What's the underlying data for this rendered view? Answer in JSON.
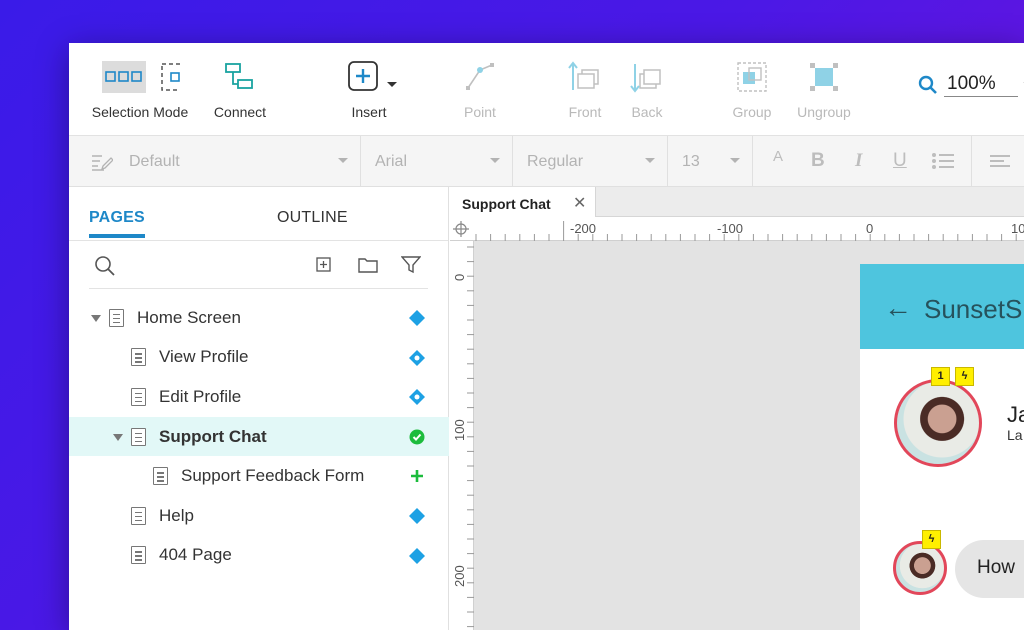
{
  "toolbar": {
    "selection_mode": "Selection Mode",
    "connect": "Connect",
    "insert": "Insert",
    "point": "Point",
    "front": "Front",
    "back": "Back",
    "group": "Group",
    "ungroup": "Ungroup",
    "zoom": "100%"
  },
  "format_bar": {
    "style": "Default",
    "font": "Arial",
    "weight": "Regular",
    "size": "13"
  },
  "left_panel": {
    "tabs": [
      "PAGES",
      "OUTLINE"
    ],
    "pages": [
      {
        "label": "Home Screen",
        "status": "diamond"
      },
      {
        "label": "View Profile",
        "status": "diamond-dot"
      },
      {
        "label": "Edit Profile",
        "status": "diamond-dot"
      },
      {
        "label": "Support Chat",
        "status": "check"
      },
      {
        "label": "Support Feedback Form",
        "status": "plus"
      },
      {
        "label": "Help",
        "status": "diamond"
      },
      {
        "label": "404 Page",
        "status": "diamond"
      }
    ]
  },
  "document": {
    "tab_label": "Support Chat",
    "ruler_h": [
      "-200",
      "-100",
      "0",
      "10"
    ],
    "ruler_v": [
      "0",
      "100",
      "200"
    ]
  },
  "app_preview": {
    "title": "SunsetS",
    "name_partial": "Ja",
    "sub_partial": "La",
    "badge_count": "1",
    "chat_text": "How"
  },
  "colors": {
    "accent": "#1e88c8",
    "diamond": "#1da1e4",
    "check": "#1cbc3c",
    "appbar": "#4ec5de",
    "selection_row": "#e2f8f7"
  }
}
